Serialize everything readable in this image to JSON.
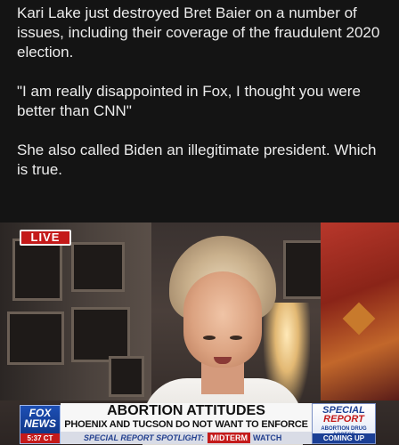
{
  "post": {
    "paragraphs": [
      "Kari Lake just destroyed Bret Baier on a number of issues, including their coverage of the fraudulent 2020 election.",
      "\"I am really disappointed in Fox, I thought you were better than CNN\"",
      "She also called Biden an illegitimate president. Which is true."
    ]
  },
  "video": {
    "live_label": "LIVE",
    "network": {
      "line1": "FOX",
      "line2": "NEWS",
      "time": "5:37 CT"
    },
    "headline": "ABORTION ATTITUDES",
    "subhead": "PHOENIX AND TUCSON DO NOT WANT TO ENFORCE LAW",
    "ticker": {
      "segment": "SPECIAL REPORT SPOTLIGHT:",
      "tag": "MIDTERM",
      "label": "WATCH"
    },
    "side_panel": {
      "line1": "SPECIAL",
      "line2": "REPORT",
      "caption": "ABORTION DRUG ACCESS",
      "status": "COMING UP"
    }
  },
  "colors": {
    "background": "#141414",
    "text": "#ececec",
    "live_red": "#c41a1a",
    "fox_blue": "#1d4fb5"
  }
}
